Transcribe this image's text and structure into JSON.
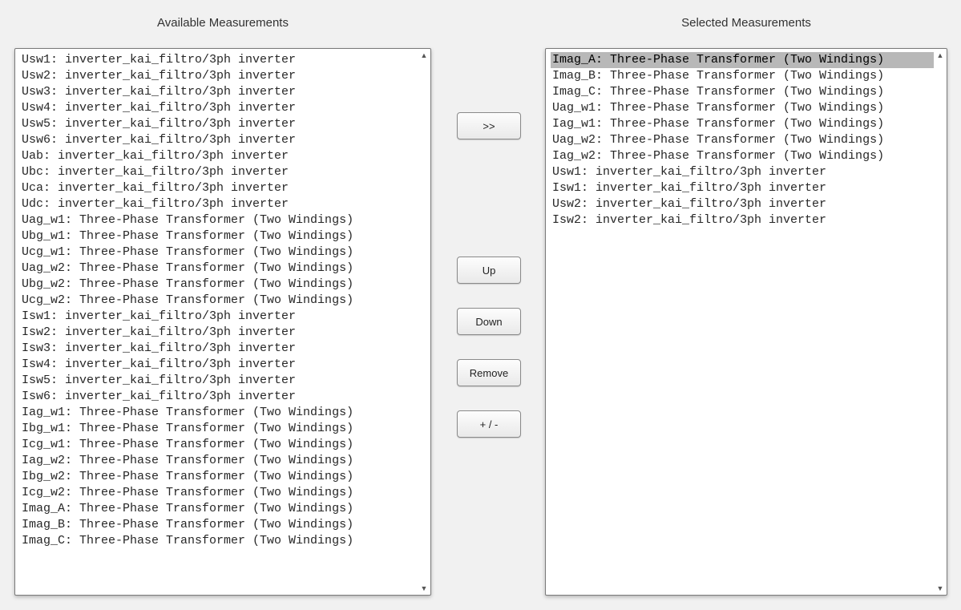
{
  "titles": {
    "available": "Available Measurements",
    "selected": "Selected Measurements"
  },
  "buttons": {
    "add": ">>",
    "up": "Up",
    "down": "Down",
    "remove": "Remove",
    "sign": "+ / -"
  },
  "available_items": [
    "Usw1: inverter_kai_filtro/3ph inverter",
    "Usw2: inverter_kai_filtro/3ph inverter",
    "Usw3: inverter_kai_filtro/3ph inverter",
    "Usw4: inverter_kai_filtro/3ph inverter",
    "Usw5: inverter_kai_filtro/3ph inverter",
    "Usw6: inverter_kai_filtro/3ph inverter",
    "Uab: inverter_kai_filtro/3ph inverter",
    "Ubc: inverter_kai_filtro/3ph inverter",
    "Uca: inverter_kai_filtro/3ph inverter",
    "Udc: inverter_kai_filtro/3ph inverter",
    "Uag_w1: Three-Phase Transformer (Two Windings)",
    "Ubg_w1: Three-Phase Transformer (Two Windings)",
    "Ucg_w1: Three-Phase Transformer (Two Windings)",
    "Uag_w2: Three-Phase Transformer (Two Windings)",
    "Ubg_w2: Three-Phase Transformer (Two Windings)",
    "Ucg_w2: Three-Phase Transformer (Two Windings)",
    "Isw1: inverter_kai_filtro/3ph inverter",
    "Isw2: inverter_kai_filtro/3ph inverter",
    "Isw3: inverter_kai_filtro/3ph inverter",
    "Isw4: inverter_kai_filtro/3ph inverter",
    "Isw5: inverter_kai_filtro/3ph inverter",
    "Isw6: inverter_kai_filtro/3ph inverter",
    "Iag_w1: Three-Phase Transformer (Two Windings)",
    "Ibg_w1: Three-Phase Transformer (Two Windings)",
    "Icg_w1: Three-Phase Transformer (Two Windings)",
    "Iag_w2: Three-Phase Transformer (Two Windings)",
    "Ibg_w2: Three-Phase Transformer (Two Windings)",
    "Icg_w2: Three-Phase Transformer (Two Windings)",
    "Imag_A: Three-Phase Transformer (Two Windings)",
    "Imag_B: Three-Phase Transformer (Two Windings)",
    "Imag_C: Three-Phase Transformer (Two Windings)"
  ],
  "selected_items": [
    "Imag_A: Three-Phase Transformer (Two Windings)",
    "Imag_B: Three-Phase Transformer (Two Windings)",
    "Imag_C: Three-Phase Transformer (Two Windings)",
    "Uag_w1: Three-Phase Transformer (Two Windings)",
    "Iag_w1: Three-Phase Transformer (Two Windings)",
    "Uag_w2: Three-Phase Transformer (Two Windings)",
    "Iag_w2: Three-Phase Transformer (Two Windings)",
    "Usw1: inverter_kai_filtro/3ph inverter",
    "Isw1: inverter_kai_filtro/3ph inverter",
    "Usw2: inverter_kai_filtro/3ph inverter",
    "Isw2: inverter_kai_filtro/3ph inverter"
  ],
  "selected_highlight_index": 0
}
